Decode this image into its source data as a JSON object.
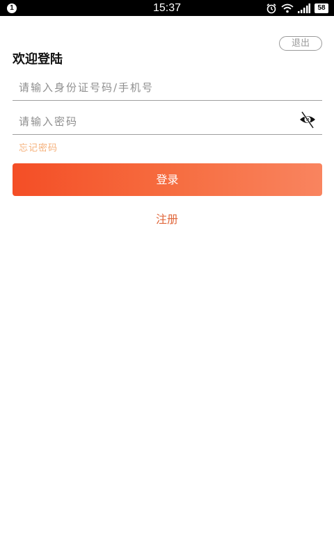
{
  "status_bar": {
    "notification_count": "1",
    "time": "15:37",
    "battery": "58",
    "icons": [
      "alarm-icon",
      "wifi-icon",
      "signal-icon",
      "battery-icon"
    ]
  },
  "header": {
    "exit_label": "退出",
    "welcome": "欢迎登陆"
  },
  "form": {
    "id_placeholder": "请输入身份证号码/手机号",
    "id_value": "",
    "password_placeholder": "请输入密码",
    "password_value": "",
    "visibility_icon": "eye-off-icon",
    "forgot_label": "忘记密码",
    "login_label": "登录",
    "register_label": "注册"
  },
  "colors": {
    "accent_start": "#f44e26",
    "accent_end": "#f9845f",
    "forgot": "#f5b07a",
    "register": "#e0663a"
  }
}
